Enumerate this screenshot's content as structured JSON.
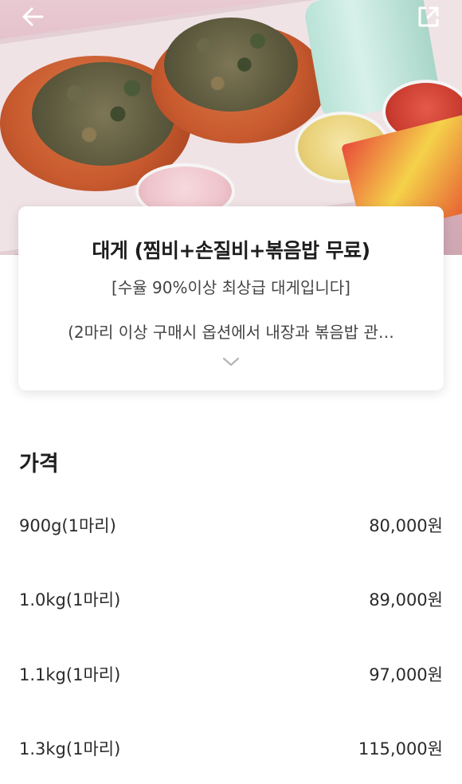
{
  "header": {
    "back_icon": "arrow-left-icon",
    "share_icon": "external-link-icon"
  },
  "product": {
    "title": "대게 (찜비+손질비+볶음밥 무료)",
    "subtitle": "[수율 90%이상 최상급 대게입니다]",
    "description": "(2마리 이상 구매시 옵션에서 내장과 볶음밥 관…",
    "expand_icon": "chevron-down-icon"
  },
  "prices": {
    "section_title": "가격",
    "rows": [
      {
        "option": "900g(1마리)",
        "price": "80,000원"
      },
      {
        "option": "1.0kg(1마리)",
        "price": "89,000원"
      },
      {
        "option": "1.1kg(1마리)",
        "price": "97,000원"
      },
      {
        "option": "1.3kg(1마리)",
        "price": "115,000원"
      }
    ]
  },
  "colors": {
    "hero_bg": "#d9b3bf",
    "card_bg": "#ffffff",
    "text_primary": "#1e1e1e"
  }
}
